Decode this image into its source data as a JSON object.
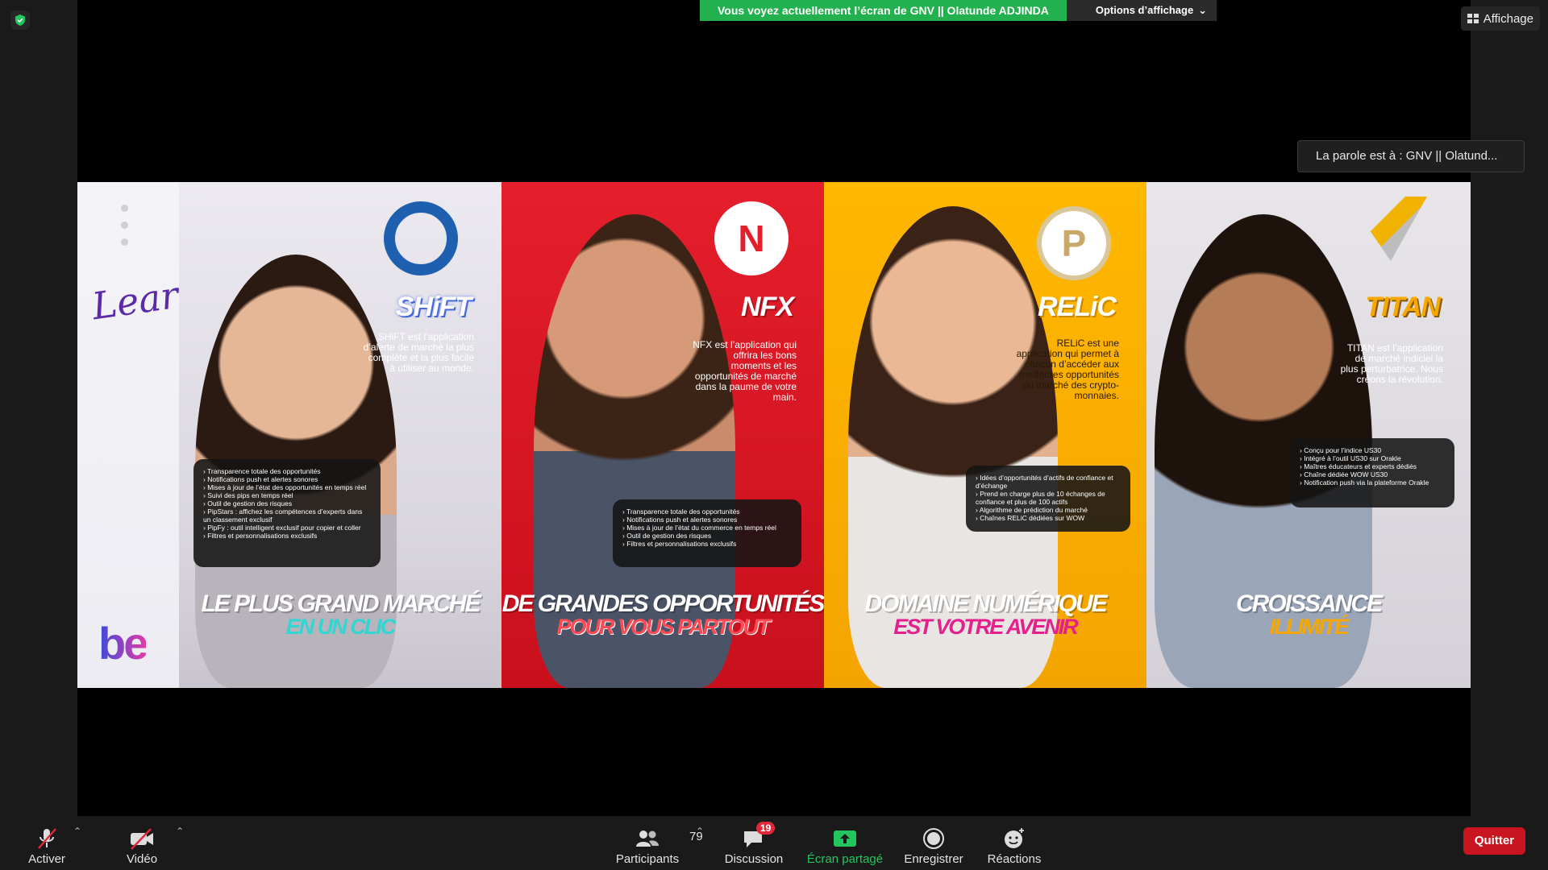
{
  "share_banner": {
    "text": "Vous voyez actuellement l’écran de GNV || Olatunde ADJINDA",
    "options_label": "Options d’affichage"
  },
  "view_button": {
    "label": "Affichage"
  },
  "speaker": {
    "text": "La parole est à : GNV || Olatund..."
  },
  "slide": {
    "strip": {
      "learn": "Learn",
      "be": "be"
    },
    "panels": [
      {
        "brand": "SHiFT",
        "logo": "shift-logo",
        "description": "SHiFT est l’application d’alerte de marché la plus complète et la plus facile à utiliser au monde.",
        "features": [
          "Transparence totale des opportunités",
          "Notifications push et alertes sonores",
          "Mises à jour de l’état des opportunités en temps réel",
          "Suivi des pips en temps réel",
          "Outil de gestion des risques",
          "PipStars : affichez les compétences d’experts dans un classement exclusif",
          "PipFy : outil intelligent exclusif pour copier et coller",
          "Filtres et personnalisations exclusifs"
        ],
        "tagline_main": "LE PLUS GRAND MARCHÉ",
        "tagline_sub": "EN UN CLIC"
      },
      {
        "brand": "NFX",
        "logo": "nfx-logo",
        "description": "NFX est l’application qui offrira les bons moments et les opportunités de marché dans la paume de votre main.",
        "features": [
          "Transparence totale des opportunités",
          "Notifications push et alertes sonores",
          "Mises à jour de l’état du commerce en temps réel",
          "Outil de gestion des risques",
          "Filtres et personnalisations exclusifs"
        ],
        "tagline_main": "DE GRANDES OPPORTUNITÉS",
        "tagline_sub": "POUR VOUS PARTOUT"
      },
      {
        "brand": "RELiC",
        "logo": "relic-logo",
        "description": "RELiC est une application qui permet à chacun d’accéder aux meilleures opportunités du marché des crypto-monnaies.",
        "features": [
          "Idées d’opportunités d’actifs de confiance et d’échange",
          "Prend en charge plus de 10 échanges de confiance et plus de 100 actifs",
          "Algorithme de prédiction du marché",
          "Chaînes RELiC dédiées sur WOW"
        ],
        "tagline_main": "DOMAINE NUMÉRIQUE",
        "tagline_sub": "EST VOTRE AVENIR"
      },
      {
        "brand": "TITAN",
        "logo": "titan-logo",
        "description": "TITAN est l’application de marché indiciel la plus perturbatrice. Nous créons la révolution.",
        "features": [
          "Conçu pour l’indice US30",
          "Intégré à l’outil US30 sur Orakle",
          "Maîtres éducateurs et experts dédiés",
          "Chaîne dédiée WOW US30",
          "Notification push via la plateforme Orakle"
        ],
        "tagline_main": "CROISSANCE",
        "tagline_sub": "ILLIMITÉ"
      }
    ]
  },
  "toolbar": {
    "mute_label": "Activer",
    "video_label": "Vidéo",
    "participants_label": "Participants",
    "participants_count": "79",
    "chat_label": "Discussion",
    "chat_badge": "19",
    "share_label": "Écran partagé",
    "record_label": "Enregistrer",
    "reactions_label": "Réactions",
    "quit_label": "Quitter"
  },
  "colors": {
    "share_green": "#23b04e",
    "quit_red": "#c8151f",
    "badge_red": "#e0283a",
    "panel_red": "#e51e2b",
    "panel_yellow": "#ffb800"
  }
}
